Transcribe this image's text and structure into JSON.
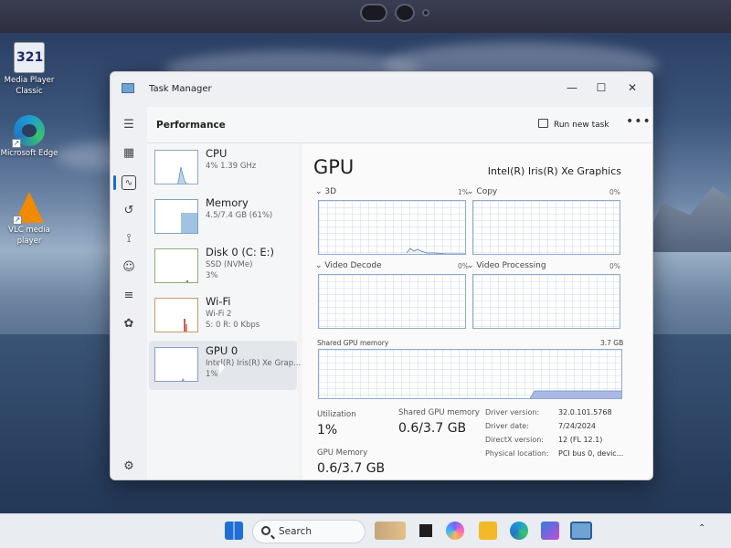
{
  "desktop": {
    "icons": [
      {
        "label": "Media Player Classic",
        "glyph": "321"
      },
      {
        "label": "Microsoft Edge"
      },
      {
        "label": "VLC media player"
      }
    ]
  },
  "window": {
    "title": "Task Manager",
    "controls": {
      "minimize": "—",
      "maximize": "☐",
      "close": "✕"
    }
  },
  "nav": {
    "icons": [
      "hamburger-menu-icon",
      "processes-icon",
      "performance-icon",
      "app-history-icon",
      "startup-apps-icon",
      "users-icon",
      "details-icon",
      "services-icon",
      "settings-icon"
    ]
  },
  "commandbar": {
    "section_title": "Performance",
    "run_new_task": "Run new task",
    "more": "•••"
  },
  "resources": [
    {
      "name": "CPU",
      "sub1": "4%  1.39 GHz",
      "sub2": ""
    },
    {
      "name": "Memory",
      "sub1": "4.5/7.4 GB (61%)",
      "sub2": ""
    },
    {
      "name": "Disk 0 (C: E:)",
      "sub1": "SSD (NVMe)",
      "sub2": "3%"
    },
    {
      "name": "Wi-Fi",
      "sub1": "Wi-Fi 2",
      "sub2": "S: 0  R: 0 Kbps"
    },
    {
      "name": "GPU 0",
      "sub1": "Intel(R) Iris(R) Xe Grap...",
      "sub2": "1%"
    }
  ],
  "detail": {
    "title": "GPU",
    "model": "Intel(R) Iris(R) Xe Graphics",
    "engines": [
      {
        "label": "3D",
        "pct": "1%"
      },
      {
        "label": "Copy",
        "pct": "0%"
      },
      {
        "label": "Video Decode",
        "pct": "0%"
      },
      {
        "label": "Video Processing",
        "pct": "0%"
      }
    ],
    "shared_memory_label": "Shared GPU memory",
    "shared_memory_max": "3.7 GB",
    "stats": {
      "utilization_label": "Utilization",
      "utilization_value": "1%",
      "shared_label": "Shared GPU memory",
      "shared_value": "0.6/3.7 GB",
      "gpu_memory_label": "GPU Memory",
      "gpu_memory_value": "0.6/3.7 GB"
    },
    "info": [
      {
        "k": "Driver version:",
        "v": "32.0.101.5768"
      },
      {
        "k": "Driver date:",
        "v": "7/24/2024"
      },
      {
        "k": "DirectX version:",
        "v": "12 (FL 12.1)"
      },
      {
        "k": "Physical location:",
        "v": "PCI bus 0, devic..."
      }
    ]
  },
  "taskbar": {
    "search_label": "Search"
  },
  "colors": {
    "accent": "#1a6ad0",
    "graph_line": "#6f8fc0",
    "graph_fill": "#a9b8e6",
    "memory_fill": "#9fc3e0",
    "wifi_spike": "#c0392b"
  }
}
